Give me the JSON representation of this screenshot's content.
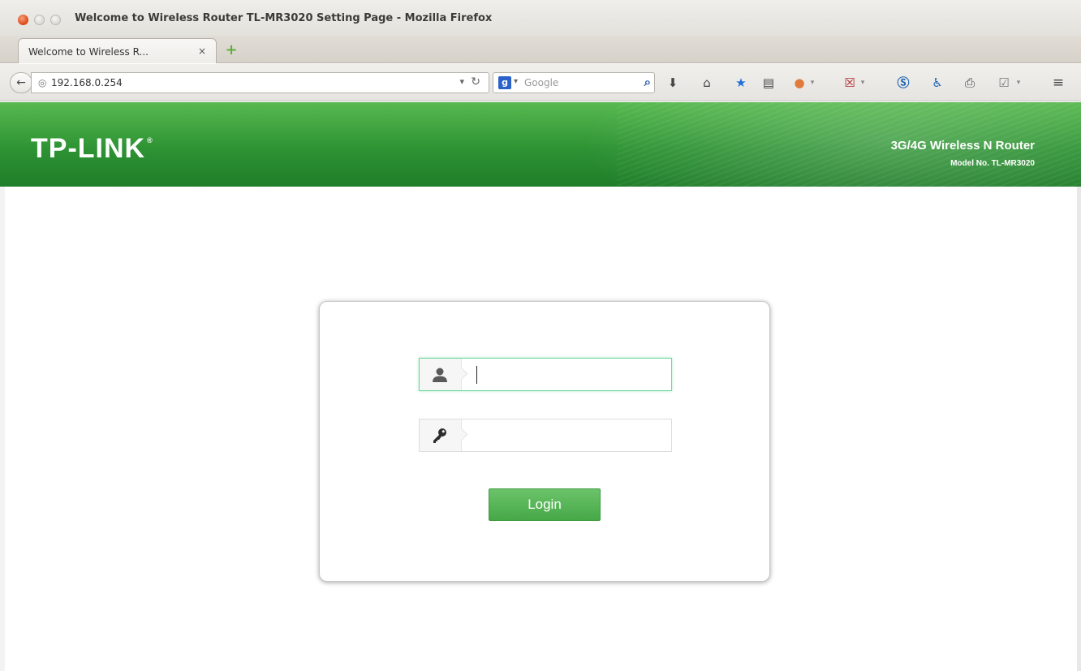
{
  "window": {
    "title": "Welcome to Wireless Router TL-MR3020 Setting Page - Mozilla Firefox"
  },
  "tabs": [
    {
      "label": "Welcome to Wireless R...",
      "close": "×",
      "active": true
    }
  ],
  "new_tab_symbol": "+",
  "navbar": {
    "url": "192.168.0.254",
    "search_placeholder": "Google",
    "search_engine_letter": "g",
    "icons": [
      "back-icon",
      "globe-icon",
      "reload-icon",
      "search-icon",
      "download-icon",
      "home-icon",
      "bookmark-star-icon",
      "bookmarks-menu-icon",
      "addon-icon",
      "addon-red-icon",
      "skype-icon",
      "accessibility-icon",
      "print-icon",
      "checklist-icon",
      "hamburger-menu-icon"
    ]
  },
  "router_header": {
    "brand": "TP-LINK",
    "registered_mark": "®",
    "product": "3G/4G Wireless N Router",
    "model": "Model No. TL-MR3020"
  },
  "login": {
    "username_value": "",
    "password_value": "",
    "button_label": "Login"
  },
  "colors": {
    "header_green": "#2e9334",
    "button_green": "#4faf4e",
    "focus_border": "#6fd79d",
    "close_button": "#df4a16"
  }
}
